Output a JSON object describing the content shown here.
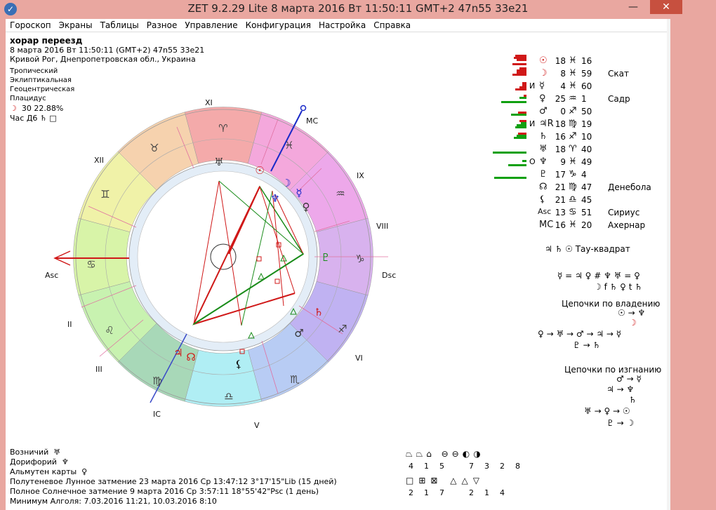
{
  "window": {
    "title": "ZET 9.2.29 Lite    8 марта 2016  Вт  11:50:11 GMT+2 47n55  33e21"
  },
  "menu": [
    "Гороскоп",
    "Экраны",
    "Таблицы",
    "Разное",
    "Управление",
    "Конфигурация",
    "Настройка",
    "Справка"
  ],
  "chart_info": {
    "name": "хорар переезд",
    "datetime": "8 марта 2016  Вт  11:50:11 (GMT+2) 47n55  33e21",
    "place": "Кривой Рог, Днепропетровская обл., Украина",
    "zodiac": "Тропический",
    "coords": "Эклиптикальная",
    "center": "Геоцентрическая",
    "houses": "Плацидус",
    "moon_phase": "30 22.88%",
    "hour_label": "Час Д6"
  },
  "houses": {
    "XI": "XI",
    "XII": "XII",
    "II": "II",
    "III": "III",
    "V": "V",
    "VI": "VI",
    "VIII": "VIII",
    "IX": "IX",
    "asc": "Asc",
    "dsc": "Dsc",
    "mc": "MC",
    "ic": "IC"
  },
  "planets": [
    {
      "sym": "☉",
      "tag": "",
      "deg": "18",
      "sign": "♓",
      "min": "16",
      "star": "",
      "color": "#d01818"
    },
    {
      "sym": "☽",
      "tag": "",
      "deg": "8",
      "sign": "♓",
      "min": "59",
      "star": "Скат",
      "color": "#d01818"
    },
    {
      "sym": "☿",
      "tag": "И",
      "deg": "4",
      "sign": "♓",
      "min": "60",
      "star": "",
      "color": "#111"
    },
    {
      "sym": "♀",
      "tag": "",
      "deg": "25",
      "sign": "♒",
      "min": "1",
      "star": "Садр",
      "color": "#111"
    },
    {
      "sym": "♂",
      "tag": "",
      "deg": "0",
      "sign": "♐",
      "min": "50",
      "star": "",
      "color": "#111"
    },
    {
      "sym": "♃R",
      "tag": "И",
      "deg": "18",
      "sign": "♍",
      "min": "19",
      "star": "",
      "color": "#111"
    },
    {
      "sym": "♄",
      "tag": "",
      "deg": "16",
      "sign": "♐",
      "min": "10",
      "star": "",
      "color": "#111"
    },
    {
      "sym": "♅",
      "tag": "",
      "deg": "18",
      "sign": "♈",
      "min": "40",
      "star": "",
      "color": "#111"
    },
    {
      "sym": "♆",
      "tag": "О",
      "deg": "9",
      "sign": "♓",
      "min": "49",
      "star": "",
      "color": "#111"
    },
    {
      "sym": "♇",
      "tag": "",
      "deg": "17",
      "sign": "♑",
      "min": "4",
      "star": "",
      "color": "#111"
    },
    {
      "sym": "☊",
      "tag": "",
      "deg": "21",
      "sign": "♍",
      "min": "47",
      "star": "Денебола",
      "color": "#111"
    },
    {
      "sym": "⚸",
      "tag": "",
      "deg": "21",
      "sign": "♎",
      "min": "45",
      "star": "",
      "color": "#111"
    },
    {
      "sym": "Asc",
      "tag": "",
      "deg": "13",
      "sign": "♋",
      "min": "51",
      "star": "Сириус",
      "color": "#111"
    },
    {
      "sym": "MC",
      "tag": "",
      "deg": "16",
      "sign": "♓",
      "min": "20",
      "star": "Ахернар",
      "color": "#111"
    }
  ],
  "right_notes": {
    "tau": "♃ ♄ ☉  Тау-квадрат",
    "rec1": "☿ = ♃  ♀ # ♆  ♅ = ♀",
    "rec2": "☽ f ♄  ♀ t ♄",
    "chains_own": "Цепочки по владению",
    "own1": "☉ → ♆",
    "own2": "☽",
    "own3": "♀ → ♅ → ♂ → ♃ → ☿",
    "own4": "♇ → ♄",
    "chains_exile": "Цепочки по изгнанию",
    "ex1": "♂ → ☿",
    "ex2": "♃ → ♆",
    "ex3": "♄",
    "ex4": "♅ → ♀ → ☉",
    "ex5": "♇ → ☽"
  },
  "bottom": {
    "vozn_label": "Возничий",
    "vozn_sym": "♅",
    "dor_label": "Дорифорий",
    "dor_sym": "♆",
    "alm_label": "Альмутен карты",
    "alm_sym": "♀",
    "lunar": "Полутеневое Лунное затмение 23 марта 2016 Ср 13:47:12  3°17'15\"Lib (15 дней)",
    "solar": "Полное Солнечное затмение 9 марта 2016 Ср  3:57:11 18°55'42\"Psc (1 день)",
    "algol": "Минимум Алголя: 7.03.2016 11:21,  10.03.2016  8:10"
  },
  "aspect_counts": {
    "row1": [
      "4",
      "1",
      "5",
      "7",
      "3",
      "2",
      "8"
    ],
    "row2": [
      "2",
      "1",
      "7",
      "2",
      "1",
      "4"
    ]
  }
}
